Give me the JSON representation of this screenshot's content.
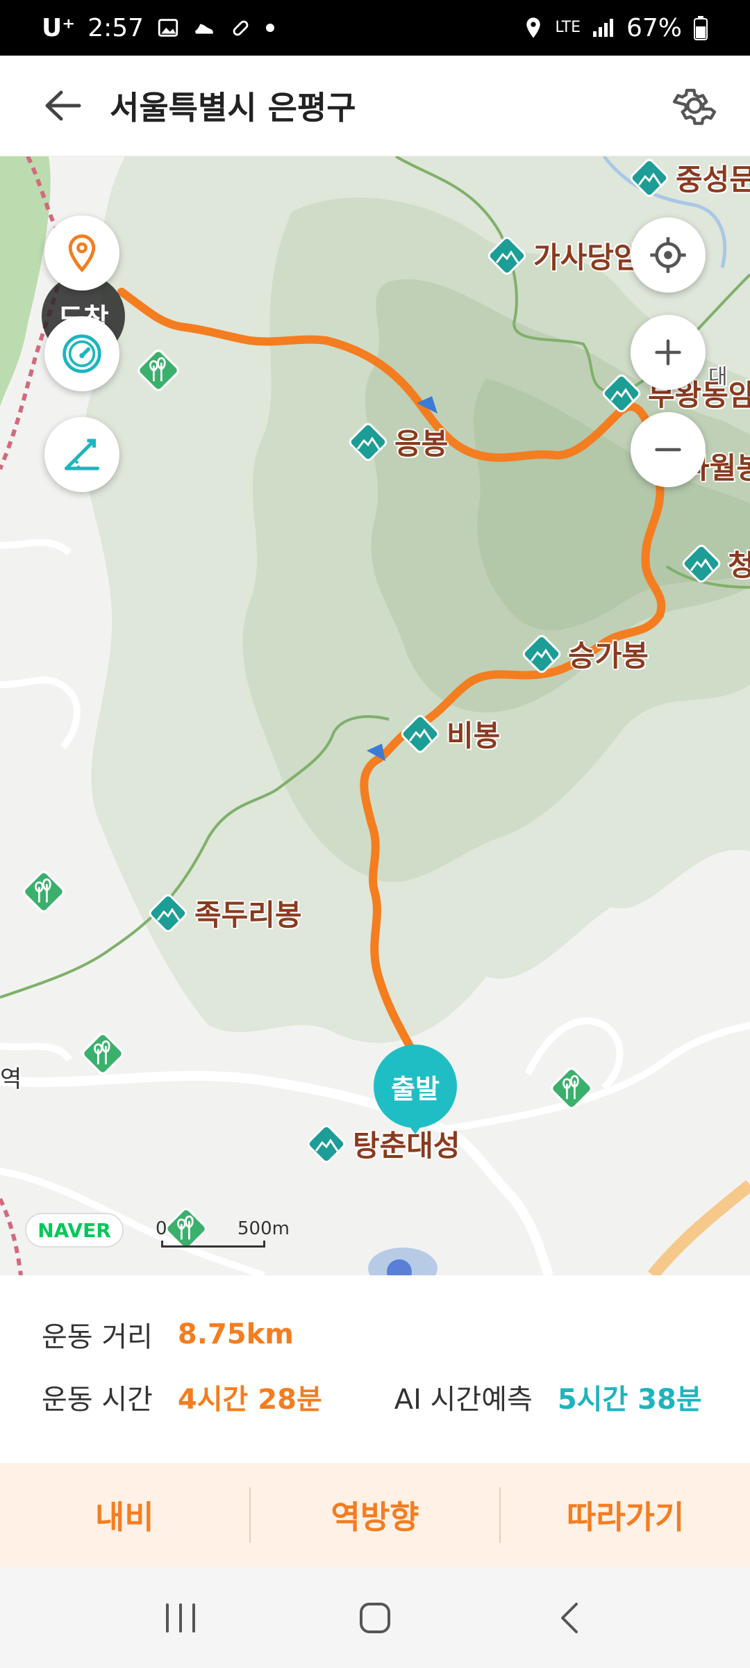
{
  "status_bar": {
    "carrier": "U⁺",
    "time": "2:57",
    "network": "LTE",
    "battery": "67%"
  },
  "header": {
    "title": "서울특별시 은평구"
  },
  "map": {
    "arrival_label": "도착",
    "start_label": "출발",
    "provider_logo": "NAVER",
    "scale_zero": "0",
    "scale_distance": "500m",
    "peaks": [
      {
        "name": "응봉"
      },
      {
        "name": "승가봉"
      },
      {
        "name": "비봉"
      },
      {
        "name": "족두리봉"
      },
      {
        "name": "탕춘대성"
      },
      {
        "name": "가사당암문"
      },
      {
        "name": "중성문"
      },
      {
        "name": "부왕동암문"
      },
      {
        "name": "나월봉"
      },
      {
        "name": "청"
      }
    ],
    "partial_label_left": "역",
    "partial_label_dae": "대",
    "route_color": "#f47d20",
    "accent_teal": "#1cb5be"
  },
  "info": {
    "distance_label": "운동 거리",
    "distance_value": "8.75km",
    "time_label": "운동 시간",
    "time_value": "4시간 28분",
    "ai_label": "AI 시간예측",
    "ai_value": "5시간 38분"
  },
  "actions": {
    "navi": "내비",
    "reverse": "역방향",
    "follow": "따라가기"
  }
}
